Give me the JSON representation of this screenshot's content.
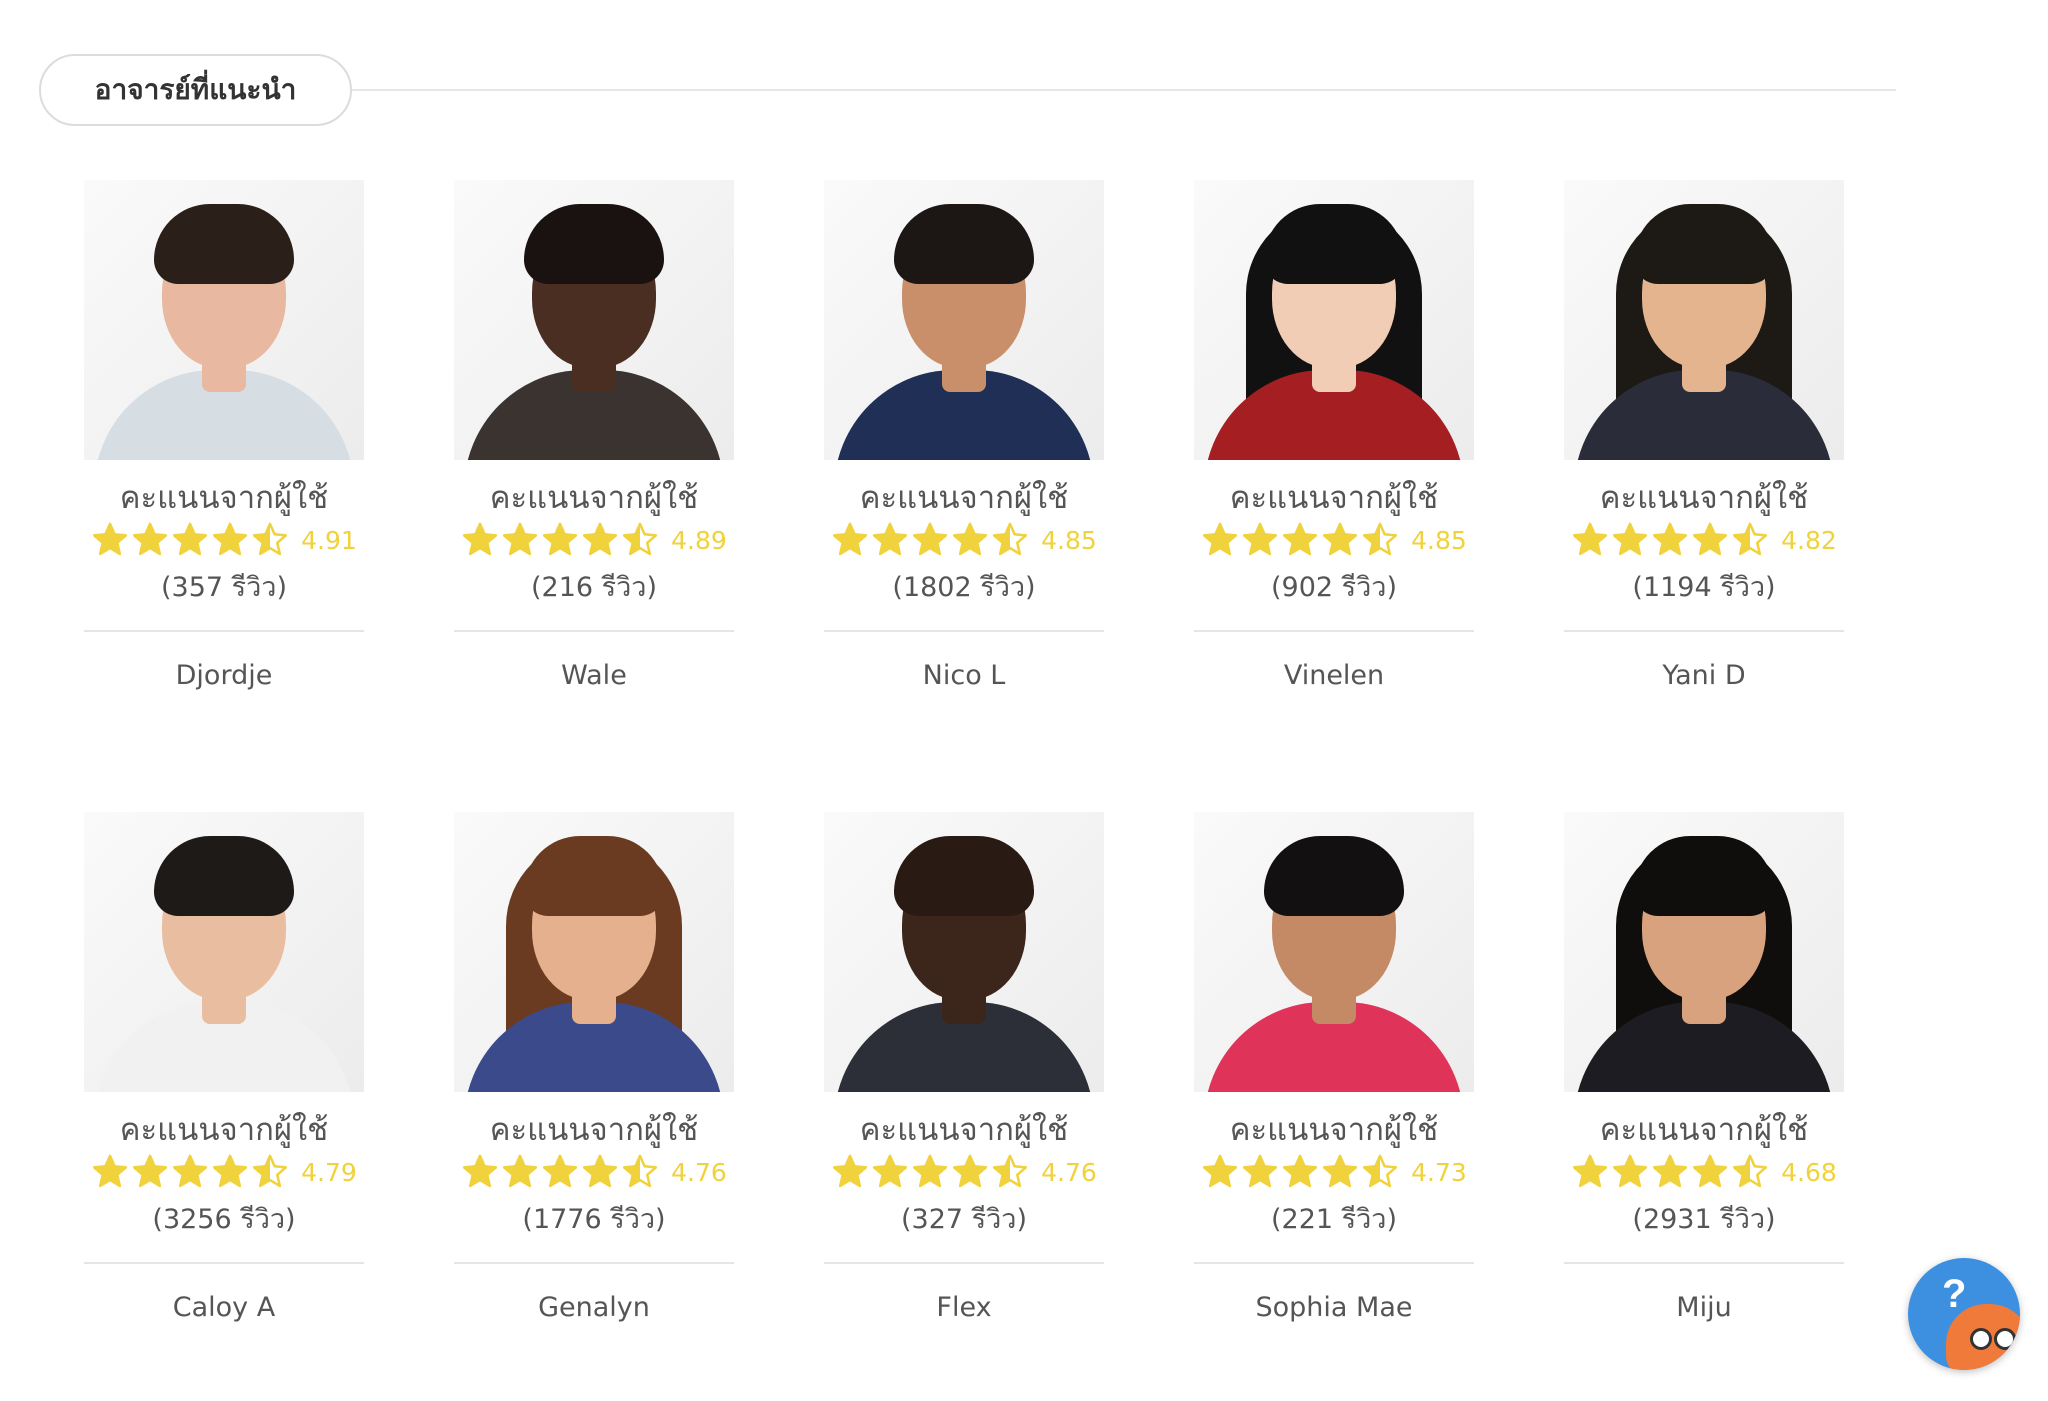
{
  "section": {
    "title": "อาจารย์ที่แนะนำ"
  },
  "colors": {
    "star": "#f0d23c",
    "star_empty": "#ffffff",
    "help_bg": "#3d8fe0",
    "mascot": "#f07a3a"
  },
  "tutors": [
    {
      "name": "Djordje",
      "rating_label": "คะแนนจากผู้ใช้",
      "rating": 4.91,
      "score": "4.91",
      "reviews": "(357 รีวิว)",
      "stars": 4.5
    },
    {
      "name": "Wale",
      "rating_label": "คะแนนจากผู้ใช้",
      "rating": 4.89,
      "score": "4.89",
      "reviews": "(216 รีวิว)",
      "stars": 4.5
    },
    {
      "name": "Nico L",
      "rating_label": "คะแนนจากผู้ใช้",
      "rating": 4.85,
      "score": "4.85",
      "reviews": "(1802 รีวิว)",
      "stars": 4.5
    },
    {
      "name": "Vinelen",
      "rating_label": "คะแนนจากผู้ใช้",
      "rating": 4.85,
      "score": "4.85",
      "reviews": "(902 รีวิว)",
      "stars": 4.5
    },
    {
      "name": "Yani D",
      "rating_label": "คะแนนจากผู้ใช้",
      "rating": 4.82,
      "score": "4.82",
      "reviews": "(1194 รีวิว)",
      "stars": 4.5
    },
    {
      "name": "Caloy A",
      "rating_label": "คะแนนจากผู้ใช้",
      "rating": 4.79,
      "score": "4.79",
      "reviews": "(3256 รีวิว)",
      "stars": 4.5
    },
    {
      "name": "Genalyn",
      "rating_label": "คะแนนจากผู้ใช้",
      "rating": 4.76,
      "score": "4.76",
      "reviews": "(1776 รีวิว)",
      "stars": 4.5
    },
    {
      "name": "Flex",
      "rating_label": "คะแนนจากผู้ใช้",
      "rating": 4.76,
      "score": "4.76",
      "reviews": "(327 รีวิว)",
      "stars": 4.5
    },
    {
      "name": "Sophia Mae",
      "rating_label": "คะแนนจากผู้ใช้",
      "rating": 4.73,
      "score": "4.73",
      "reviews": "(221 รีวิว)",
      "stars": 4.5
    },
    {
      "name": "Miju",
      "rating_label": "คะแนนจากผู้ใช้",
      "rating": 4.68,
      "score": "4.68",
      "reviews": "(2931 รีวิว)",
      "stars": 4.5
    }
  ],
  "help_widget": {
    "symbol": "?",
    "icon": "help-mascot-icon"
  }
}
